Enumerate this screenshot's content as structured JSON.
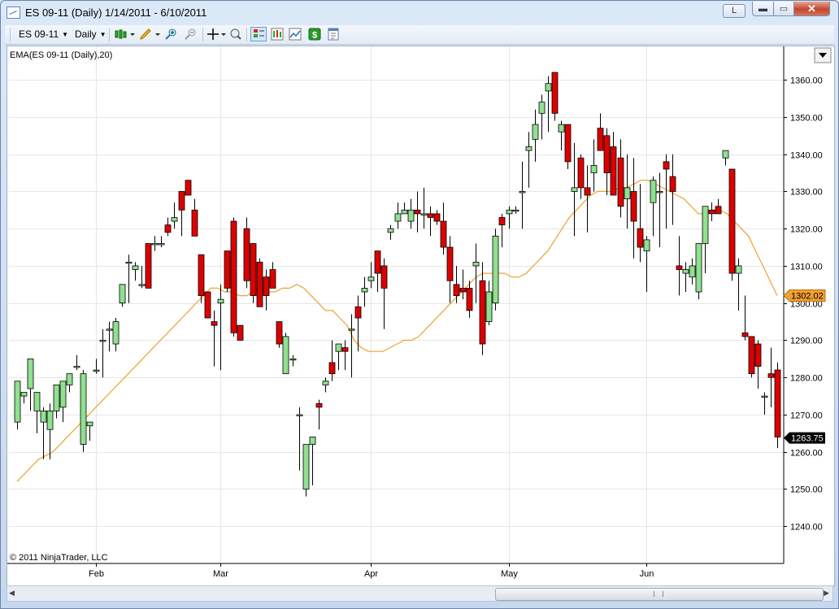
{
  "window": {
    "title": "ES 09-11 (Daily)  1/14/2011 - 6/10/2011",
    "link_button": "L",
    "min_glyph": "▬",
    "max_glyph": "▭",
    "close_glyph": "✕"
  },
  "toolbar": {
    "instrument": "ES 09-11",
    "interval": "Daily"
  },
  "chart": {
    "indicator_label": "EMA(ES 09-11 (Daily),20)",
    "copyright": "© 2011 NinjaTrader, LLC",
    "ema_price_label": "1302.02",
    "last_price_label": "1263.75",
    "colors": {
      "up": "#90e090",
      "down": "#dd0000",
      "ema": "#f0a030",
      "grid": "#e6e6e6"
    }
  },
  "chart_data": {
    "type": "candlestick",
    "x_ticks": [
      "Feb",
      "Mar",
      "Apr",
      "May",
      "Jun"
    ],
    "y_ticks": [
      1240,
      1250,
      1260,
      1270,
      1280,
      1290,
      1300,
      1310,
      1320,
      1330,
      1340,
      1350,
      1360
    ],
    "ylim": [
      1230,
      1369
    ],
    "series_note": "",
    "ema": [
      1252,
      1254,
      1256,
      1258,
      1259,
      1260,
      1262,
      1264,
      1266,
      1268,
      1270,
      1272,
      1274,
      1276,
      1278,
      1280,
      1282,
      1284,
      1286,
      1288,
      1290,
      1292,
      1294,
      1296,
      1298,
      1300,
      1302,
      1304,
      1304,
      1303,
      1303,
      1302,
      1302,
      1303,
      1304,
      1303,
      1303,
      1304,
      1304,
      1305,
      1304,
      1302,
      1300,
      1298,
      1298,
      1296,
      1294,
      1290,
      1288,
      1287,
      1287,
      1287,
      1288,
      1289,
      1290,
      1290,
      1291,
      1293,
      1295,
      1297,
      1299,
      1301,
      1303,
      1305,
      1307,
      1308,
      1308,
      1308,
      1308,
      1307,
      1307,
      1308,
      1310,
      1312,
      1314,
      1317,
      1320,
      1323,
      1325,
      1327,
      1329,
      1330,
      1330,
      1330,
      1331,
      1331,
      1332,
      1333,
      1333,
      1332,
      1331,
      1330,
      1329,
      1328,
      1326,
      1324,
      1324,
      1325,
      1325,
      1324,
      1322,
      1320,
      1318,
      1314,
      1310,
      1306,
      1302
    ],
    "candles": [
      [
        1268,
        1279,
        1266,
        1279
      ],
      [
        1275,
        1276,
        1273,
        1276
      ],
      [
        1277,
        1285,
        1271,
        1285
      ],
      [
        1271,
        1276,
        1265,
        1276
      ],
      [
        1268,
        1272,
        1258,
        1271
      ],
      [
        1266,
        1273,
        1258,
        1271
      ],
      [
        1271,
        1278,
        1269,
        1278
      ],
      [
        1272,
        1279,
        1268,
        1279
      ],
      [
        1278,
        1281,
        1276,
        1281
      ],
      [
        1283,
        1286,
        1282,
        1283
      ],
      [
        1262,
        1282,
        1260,
        1281
      ],
      [
        1267,
        1268,
        1263,
        1268
      ],
      [
        1282,
        1285,
        1281,
        1282
      ],
      [
        1290,
        1293,
        1280,
        1290
      ],
      [
        1293,
        1295,
        1287,
        1293
      ],
      [
        1289,
        1296,
        1287,
        1295
      ],
      [
        1300,
        1305,
        1299,
        1305
      ],
      [
        1311,
        1313,
        1300,
        1311
      ],
      [
        1309,
        1311,
        1306,
        1310
      ],
      [
        1305,
        1310,
        1304,
        1305
      ],
      [
        1316,
        1316,
        1304,
        1304
      ],
      [
        1316,
        1318,
        1314,
        1316
      ],
      [
        1316,
        1318,
        1315,
        1316
      ],
      [
        1321,
        1323,
        1318,
        1319
      ],
      [
        1322,
        1327,
        1320,
        1323
      ],
      [
        1330,
        1330,
        1318,
        1325
      ],
      [
        1333,
        1333,
        1329,
        1329
      ],
      [
        1325,
        1328,
        1318,
        1318
      ],
      [
        1313,
        1313,
        1300,
        1302
      ],
      [
        1303,
        1303,
        1296,
        1296
      ],
      [
        1295,
        1298,
        1283,
        1294
      ],
      [
        1300,
        1305,
        1282,
        1301
      ],
      [
        1314,
        1314,
        1303,
        1304
      ],
      [
        1322,
        1323,
        1291,
        1292
      ],
      [
        1294,
        1294,
        1290,
        1290
      ],
      [
        1320,
        1323,
        1304,
        1306
      ],
      [
        1316,
        1316,
        1300,
        1302
      ],
      [
        1311,
        1312,
        1299,
        1299
      ],
      [
        1307,
        1309,
        1298,
        1302
      ],
      [
        1309,
        1311,
        1304,
        1304
      ],
      [
        1295,
        1295,
        1288,
        1289
      ],
      [
        1281,
        1292,
        1281,
        1291
      ],
      [
        1285,
        1286,
        1283,
        1285
      ],
      [
        1270,
        1272,
        1255,
        1270
      ],
      [
        1250,
        1262,
        1248,
        1262
      ],
      [
        1262,
        1264,
        1251,
        1264
      ],
      [
        1273,
        1274,
        1266,
        1272
      ],
      [
        1278,
        1280,
        1276,
        1279
      ],
      [
        1284,
        1290,
        1279,
        1281
      ],
      [
        1287,
        1289,
        1282,
        1289
      ],
      [
        1288,
        1290,
        1282,
        1287
      ],
      [
        1293,
        1297,
        1280,
        1293
      ],
      [
        1299,
        1302,
        1287,
        1296
      ],
      [
        1303,
        1307,
        1299,
        1304
      ],
      [
        1306,
        1311,
        1304,
        1307
      ],
      [
        1314,
        1314,
        1303,
        1308
      ],
      [
        1310,
        1312,
        1293,
        1304
      ],
      [
        1319,
        1321,
        1317,
        1320
      ],
      [
        1322,
        1327,
        1320,
        1324
      ],
      [
        1324,
        1327,
        1324,
        1325
      ],
      [
        1322,
        1328,
        1320,
        1325
      ],
      [
        1325,
        1330,
        1319,
        1324
      ],
      [
        1324,
        1331,
        1320,
        1324
      ],
      [
        1324,
        1326,
        1318,
        1323
      ],
      [
        1324,
        1325,
        1321,
        1322
      ],
      [
        1322,
        1327,
        1313,
        1315
      ],
      [
        1315,
        1318,
        1300,
        1306
      ],
      [
        1305,
        1310,
        1300,
        1302
      ],
      [
        1304,
        1309,
        1301,
        1303
      ],
      [
        1304,
        1306,
        1296,
        1298
      ],
      [
        1310,
        1316,
        1300,
        1311
      ],
      [
        1306,
        1311,
        1286,
        1289
      ],
      [
        1295,
        1306,
        1294,
        1303
      ],
      [
        1300,
        1320,
        1298,
        1318
      ],
      [
        1323,
        1324,
        1315,
        1321
      ],
      [
        1324,
        1326,
        1320,
        1325
      ],
      [
        1325,
        1326,
        1324,
        1325
      ],
      [
        1330,
        1338,
        1320,
        1330
      ],
      [
        1341,
        1346,
        1331,
        1342
      ],
      [
        1344,
        1352,
        1338,
        1348
      ],
      [
        1351,
        1356,
        1344,
        1354
      ],
      [
        1357,
        1361,
        1346,
        1359
      ],
      [
        1362,
        1362,
        1349,
        1351
      ],
      [
        1346,
        1349,
        1341,
        1348
      ],
      [
        1348,
        1348,
        1336,
        1338
      ],
      [
        1330,
        1343,
        1318,
        1331
      ],
      [
        1339,
        1340,
        1328,
        1331
      ],
      [
        1331,
        1337,
        1319,
        1329
      ],
      [
        1335,
        1344,
        1330,
        1337
      ],
      [
        1347,
        1351,
        1342,
        1341
      ],
      [
        1345,
        1347,
        1329,
        1335
      ],
      [
        1342,
        1346,
        1332,
        1329
      ],
      [
        1339,
        1344,
        1323,
        1326
      ],
      [
        1328,
        1340,
        1320,
        1331
      ],
      [
        1330,
        1339,
        1312,
        1322
      ],
      [
        1320,
        1332,
        1311,
        1315
      ],
      [
        1314,
        1318,
        1303,
        1317
      ],
      [
        1327,
        1334,
        1318,
        1333
      ],
      [
        1330,
        1335,
        1315,
        1330
      ],
      [
        1338,
        1340,
        1320,
        1336
      ],
      [
        1334,
        1340,
        1321,
        1330
      ],
      [
        1310,
        1318,
        1302,
        1309
      ],
      [
        1308,
        1311,
        1303,
        1309
      ],
      [
        1307,
        1312,
        1305,
        1310
      ],
      [
        1303,
        1313,
        1301,
        1316
      ],
      [
        1316,
        1326,
        1308,
        1326
      ],
      [
        1325,
        1327,
        1322,
        1324
      ],
      [
        1326,
        1328,
        1324,
        1324
      ],
      [
        1339,
        1341,
        1337,
        1341
      ],
      [
        1336,
        1336,
        1306,
        1308
      ],
      [
        1308,
        1312,
        1298,
        1310
      ],
      [
        1292,
        1302,
        1290,
        1291
      ],
      [
        1291,
        1291,
        1280,
        1281
      ],
      [
        1289,
        1290,
        1277,
        1283
      ],
      [
        1275,
        1276,
        1270,
        1275
      ],
      [
        1281,
        1288,
        1272,
        1280
      ],
      [
        1282,
        1284,
        1261,
        1264
      ]
    ]
  }
}
